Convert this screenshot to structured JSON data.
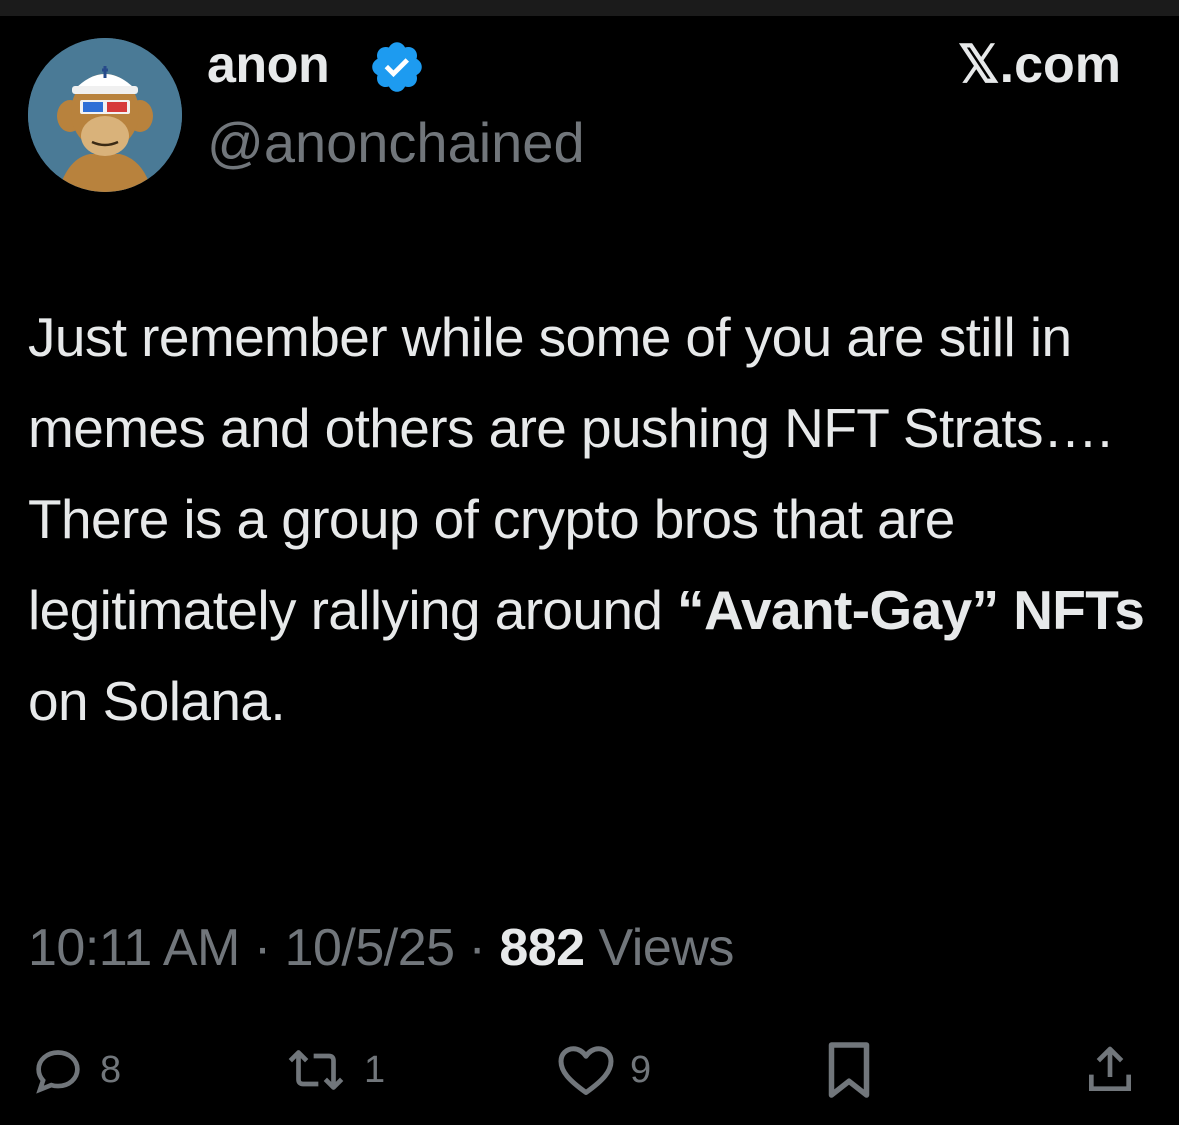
{
  "author": {
    "display_name": "anon",
    "handle": "@anonchained",
    "verified": true,
    "avatar": "bored-ape-avatar"
  },
  "site_label": "𝕏.com",
  "tweet": {
    "text_before": "Just remember while some of you are still in memes and others are pushing NFT Strats…. There is a group of crypto bros that are legitimately rallying around ",
    "bold_quote": "“Avant-Gay”",
    "bold_term": "NFTs",
    "text_after": "on Solana."
  },
  "meta": {
    "time": "10:11 AM",
    "separator": "·",
    "date": "10/5/25",
    "views_count": "882",
    "views_label": "Views"
  },
  "actions": {
    "replies": {
      "icon": "reply-icon",
      "count": "8"
    },
    "retweets": {
      "icon": "retweet-icon",
      "count": "1"
    },
    "likes": {
      "icon": "heart-icon",
      "count": "9"
    },
    "bookmark": {
      "icon": "bookmark-icon"
    },
    "share": {
      "icon": "share-icon"
    }
  },
  "colors": {
    "background": "#000000",
    "text": "#e7e9ea",
    "secondary": "#71767b",
    "verified": "#1d9bf0"
  }
}
